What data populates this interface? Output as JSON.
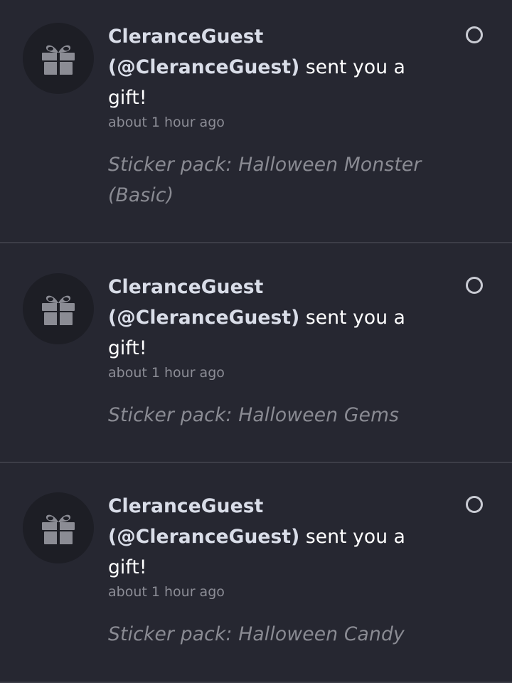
{
  "notifications": [
    {
      "sender": "CleranceGuest",
      "handle": "(@CleranceGuest)",
      "action": "sent you a gift!",
      "time": "about 1 hour ago",
      "detail": "Sticker pack: Halloween Monster (Basic)",
      "icon": "gift-icon",
      "read": false
    },
    {
      "sender": "CleranceGuest",
      "handle": "(@CleranceGuest)",
      "action": "sent you a gift!",
      "time": "about 1 hour ago",
      "detail": "Sticker pack: Halloween Gems",
      "icon": "gift-icon",
      "read": false
    },
    {
      "sender": "CleranceGuest",
      "handle": "(@CleranceGuest)",
      "action": "sent you a gift!",
      "time": "about 1 hour ago",
      "detail": "Sticker pack: Halloween Candy",
      "icon": "gift-icon",
      "read": false
    }
  ],
  "colors": {
    "background": "#262731",
    "avatar_bg": "#1d1e25",
    "icon": "#8b8c94",
    "sender_text": "#d9dde8",
    "secondary_text": "#8c8d96",
    "divider": "#3c3d47"
  }
}
